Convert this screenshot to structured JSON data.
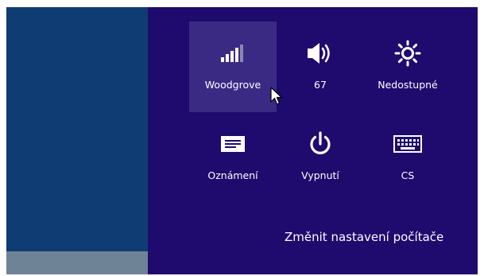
{
  "settings_panel": {
    "tiles": [
      {
        "label": "Woodgrove",
        "icon": "wifi-signal-icon",
        "hovered": true
      },
      {
        "label": "67",
        "icon": "volume-icon"
      },
      {
        "label": "Nedostupné",
        "icon": "brightness-icon"
      },
      {
        "label": "Oznámení",
        "icon": "notifications-icon"
      },
      {
        "label": "Vypnutí",
        "icon": "power-icon"
      },
      {
        "label": "CS",
        "icon": "keyboard-icon"
      }
    ],
    "change_settings_link": "Změnit nastavení počítače"
  },
  "colors": {
    "charm_bg": "#1f0a6e",
    "tile_hover_bg": "#3a2a84",
    "desktop_bg": "#0f3c72",
    "taskbar_bg": "#6f8397",
    "text": "#ffffff"
  }
}
